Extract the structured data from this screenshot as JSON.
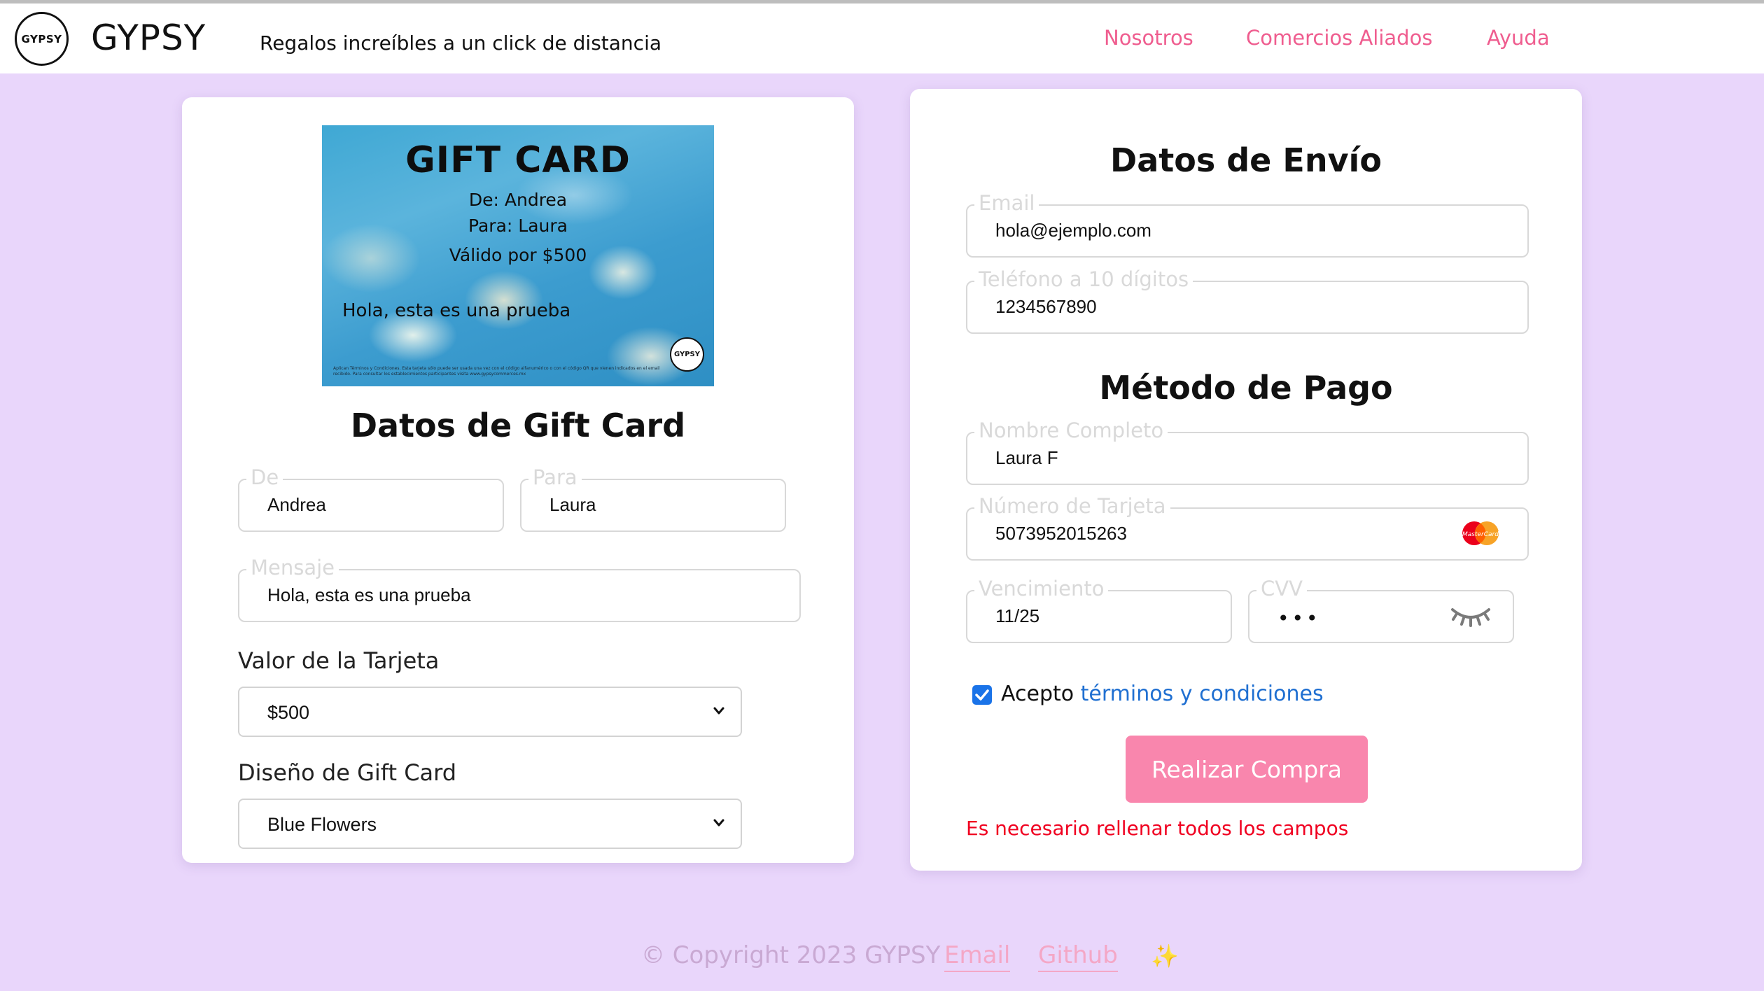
{
  "header": {
    "logo_text": "GYPSY",
    "brand": "GYPSY",
    "tagline": "Regalos increíbles a un click de distancia",
    "nav": [
      "Nosotros",
      "Comercios Aliados",
      "Ayuda"
    ]
  },
  "gift_card_preview": {
    "title": "GIFT CARD",
    "from_line": "De: Andrea",
    "to_line": "Para: Laura",
    "value_line": "Válido por $500",
    "message": "Hola, esta es una prueba",
    "logo_text": "GYPSY",
    "fine_print": "Aplican Términos y Condiciones. Esta tarjeta sólo puede ser usada una vez con el código alfanumérico o con el código QR que vienen indicados en el email recibido. Para consultar los establecimientos participantes visita www.gypsycommerces.mx"
  },
  "gift_form": {
    "title": "Datos de Gift Card",
    "from": {
      "label": "De",
      "value": "Andrea"
    },
    "to": {
      "label": "Para",
      "value": "Laura"
    },
    "message": {
      "label": "Mensaje",
      "value": "Hola, esta es una prueba"
    },
    "card_value": {
      "label": "Valor de la Tarjeta",
      "selected": "$500"
    },
    "design": {
      "label": "Diseño de Gift Card",
      "selected": "Blue Flowers"
    }
  },
  "shipping": {
    "title": "Datos de Envío",
    "email": {
      "label": "Email",
      "value": "hola@ejemplo.com"
    },
    "phone": {
      "label": "Teléfono a 10 dígitos",
      "value": "1234567890"
    }
  },
  "payment": {
    "title": "Método de Pago",
    "name": {
      "label": "Nombre Completo",
      "value": "Laura F"
    },
    "card_number": {
      "label": "Número de Tarjeta",
      "value": "5073952015263",
      "brand_icon": "mastercard-icon",
      "brand_text": "MasterCard"
    },
    "expiry": {
      "label": "Vencimiento",
      "value": "11/25"
    },
    "cvv": {
      "label": "CVV",
      "masked": "•••",
      "toggle_icon": "eye-closed-icon"
    },
    "terms_prefix": "Acepto",
    "terms_link": "términos y condiciones",
    "terms_checked": true,
    "submit_label": "Realizar Compra",
    "error": "Es necesario rellenar todos los campos"
  },
  "footer": {
    "copyright": "© Copyright 2023 GYPSY",
    "email_link": "Email",
    "github_link": "Github",
    "sparkle": "✨"
  },
  "colors": {
    "background": "#e9d6fb",
    "accent_pink": "#ef5d8f",
    "button_pink": "#f986ad",
    "error_red": "#f00020",
    "link_blue": "#1f6fd1",
    "checkbox_blue": "#1a73e8"
  }
}
